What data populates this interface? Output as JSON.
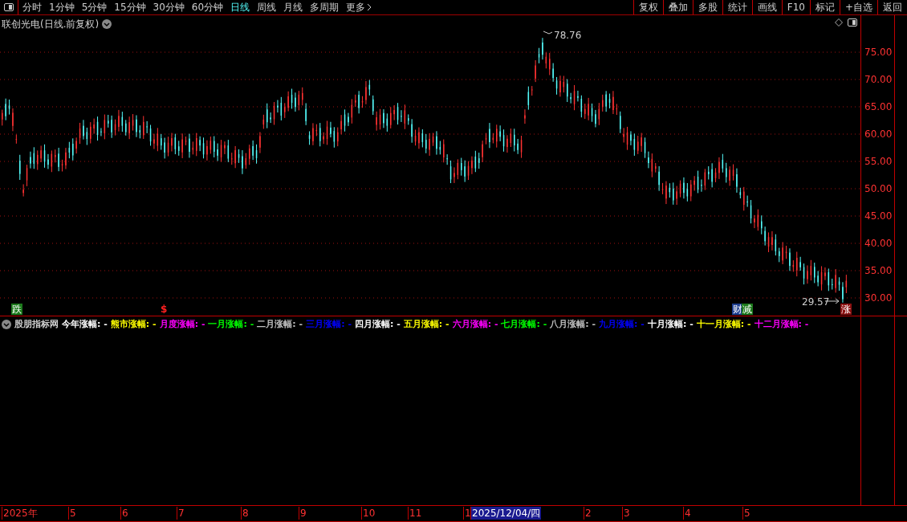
{
  "toolbar": {
    "periods": [
      {
        "label": "分时",
        "selected": false
      },
      {
        "label": "1分钟",
        "selected": false
      },
      {
        "label": "5分钟",
        "selected": false
      },
      {
        "label": "15分钟",
        "selected": false
      },
      {
        "label": "30分钟",
        "selected": false
      },
      {
        "label": "60分钟",
        "selected": false
      },
      {
        "label": "日线",
        "selected": true
      },
      {
        "label": "周线",
        "selected": false
      },
      {
        "label": "月线",
        "selected": false
      },
      {
        "label": "多周期",
        "selected": false
      }
    ],
    "more": "更多",
    "buttons": [
      "复权",
      "叠加",
      "多股",
      "统计",
      "画线",
      "F10",
      "标记",
      "+自选",
      "返回"
    ]
  },
  "chart": {
    "title": "联创光电(日线.前复权)",
    "price_labels": [
      "75.00",
      "70.00",
      "65.00",
      "60.00",
      "55.00",
      "50.00",
      "45.00",
      "40.00",
      "35.00",
      "30.00"
    ],
    "high_label": "78.76",
    "low_label": "29.57",
    "markers": [
      {
        "text": "跌",
        "kind": "box",
        "color": "#1c7a1c"
      },
      {
        "text": "$",
        "kind": "plain",
        "color": "#ff2020"
      },
      {
        "text": "财",
        "kind": "box",
        "color": "#1f3f8f"
      },
      {
        "text": "减",
        "kind": "box",
        "color": "#1c7a1c"
      },
      {
        "text": "涨",
        "kind": "box",
        "color": "#8a1010"
      }
    ]
  },
  "indicator": {
    "title": "股朋指标网",
    "items": [
      {
        "label": "今年涨幅:",
        "value": "-",
        "color": "#ffffff"
      },
      {
        "label": "熊市涨幅:",
        "value": "-",
        "color": "#ffff00"
      },
      {
        "label": "月度涨幅:",
        "value": "-",
        "color": "#ff00ff"
      },
      {
        "label": "一月涨幅:",
        "value": "-",
        "color": "#00ff00"
      },
      {
        "label": "二月涨幅:",
        "value": "-",
        "color": "#c0c0c0"
      },
      {
        "label": "三月涨幅:",
        "value": "-",
        "color": "#0000ff"
      },
      {
        "label": "四月涨幅:",
        "value": "-",
        "color": "#ffffff"
      },
      {
        "label": "五月涨幅:",
        "value": "-",
        "color": "#ffff00"
      },
      {
        "label": "六月涨幅:",
        "value": "-",
        "color": "#ff00ff"
      },
      {
        "label": "七月涨幅:",
        "value": "-",
        "color": "#00ff00"
      },
      {
        "label": "八月涨幅:",
        "value": "-",
        "color": "#c0c0c0"
      },
      {
        "label": "九月涨幅:",
        "value": "-",
        "color": "#0000ff"
      },
      {
        "label": "十月涨幅:",
        "value": "-",
        "color": "#ffffff"
      },
      {
        "label": "十一月涨幅:",
        "value": "-",
        "color": "#ffff00"
      },
      {
        "label": "十二月涨幅:",
        "value": "-",
        "color": "#ff00ff"
      }
    ]
  },
  "time_axis": {
    "labels": [
      {
        "text": "2025年",
        "selected": false
      },
      {
        "text": "5",
        "selected": false
      },
      {
        "text": "6",
        "selected": false
      },
      {
        "text": "7",
        "selected": false
      },
      {
        "text": "8",
        "selected": false
      },
      {
        "text": "9",
        "selected": false
      },
      {
        "text": "10",
        "selected": false
      },
      {
        "text": "11",
        "selected": false
      },
      {
        "text": "1",
        "selected": false
      },
      {
        "text": "2025/12/04/四",
        "selected": true
      },
      {
        "text": "2",
        "selected": false
      },
      {
        "text": "3",
        "selected": false
      },
      {
        "text": "4",
        "selected": false
      },
      {
        "text": "5",
        "selected": false
      }
    ]
  }
}
